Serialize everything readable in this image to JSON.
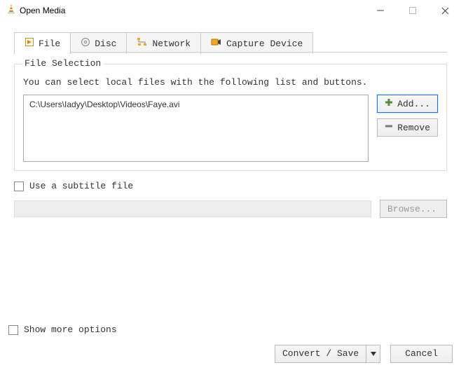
{
  "window": {
    "title": "Open Media"
  },
  "tabs": {
    "file": "File",
    "disc": "Disc",
    "network": "Network",
    "capture": "Capture Device"
  },
  "file_section": {
    "legend": "File Selection",
    "hint": "You can select local files with the following list and buttons.",
    "entries": [
      "C:\\Users\\Iadyy\\Desktop\\Videos\\Faye.avi"
    ],
    "add_label": "Add...",
    "remove_label": "Remove"
  },
  "subtitle": {
    "checkbox_label": "Use a subtitle file",
    "browse_label": "Browse..."
  },
  "footer": {
    "more_label": "Show more options",
    "convert_label": "Convert / Save",
    "cancel_label": "Cancel"
  }
}
